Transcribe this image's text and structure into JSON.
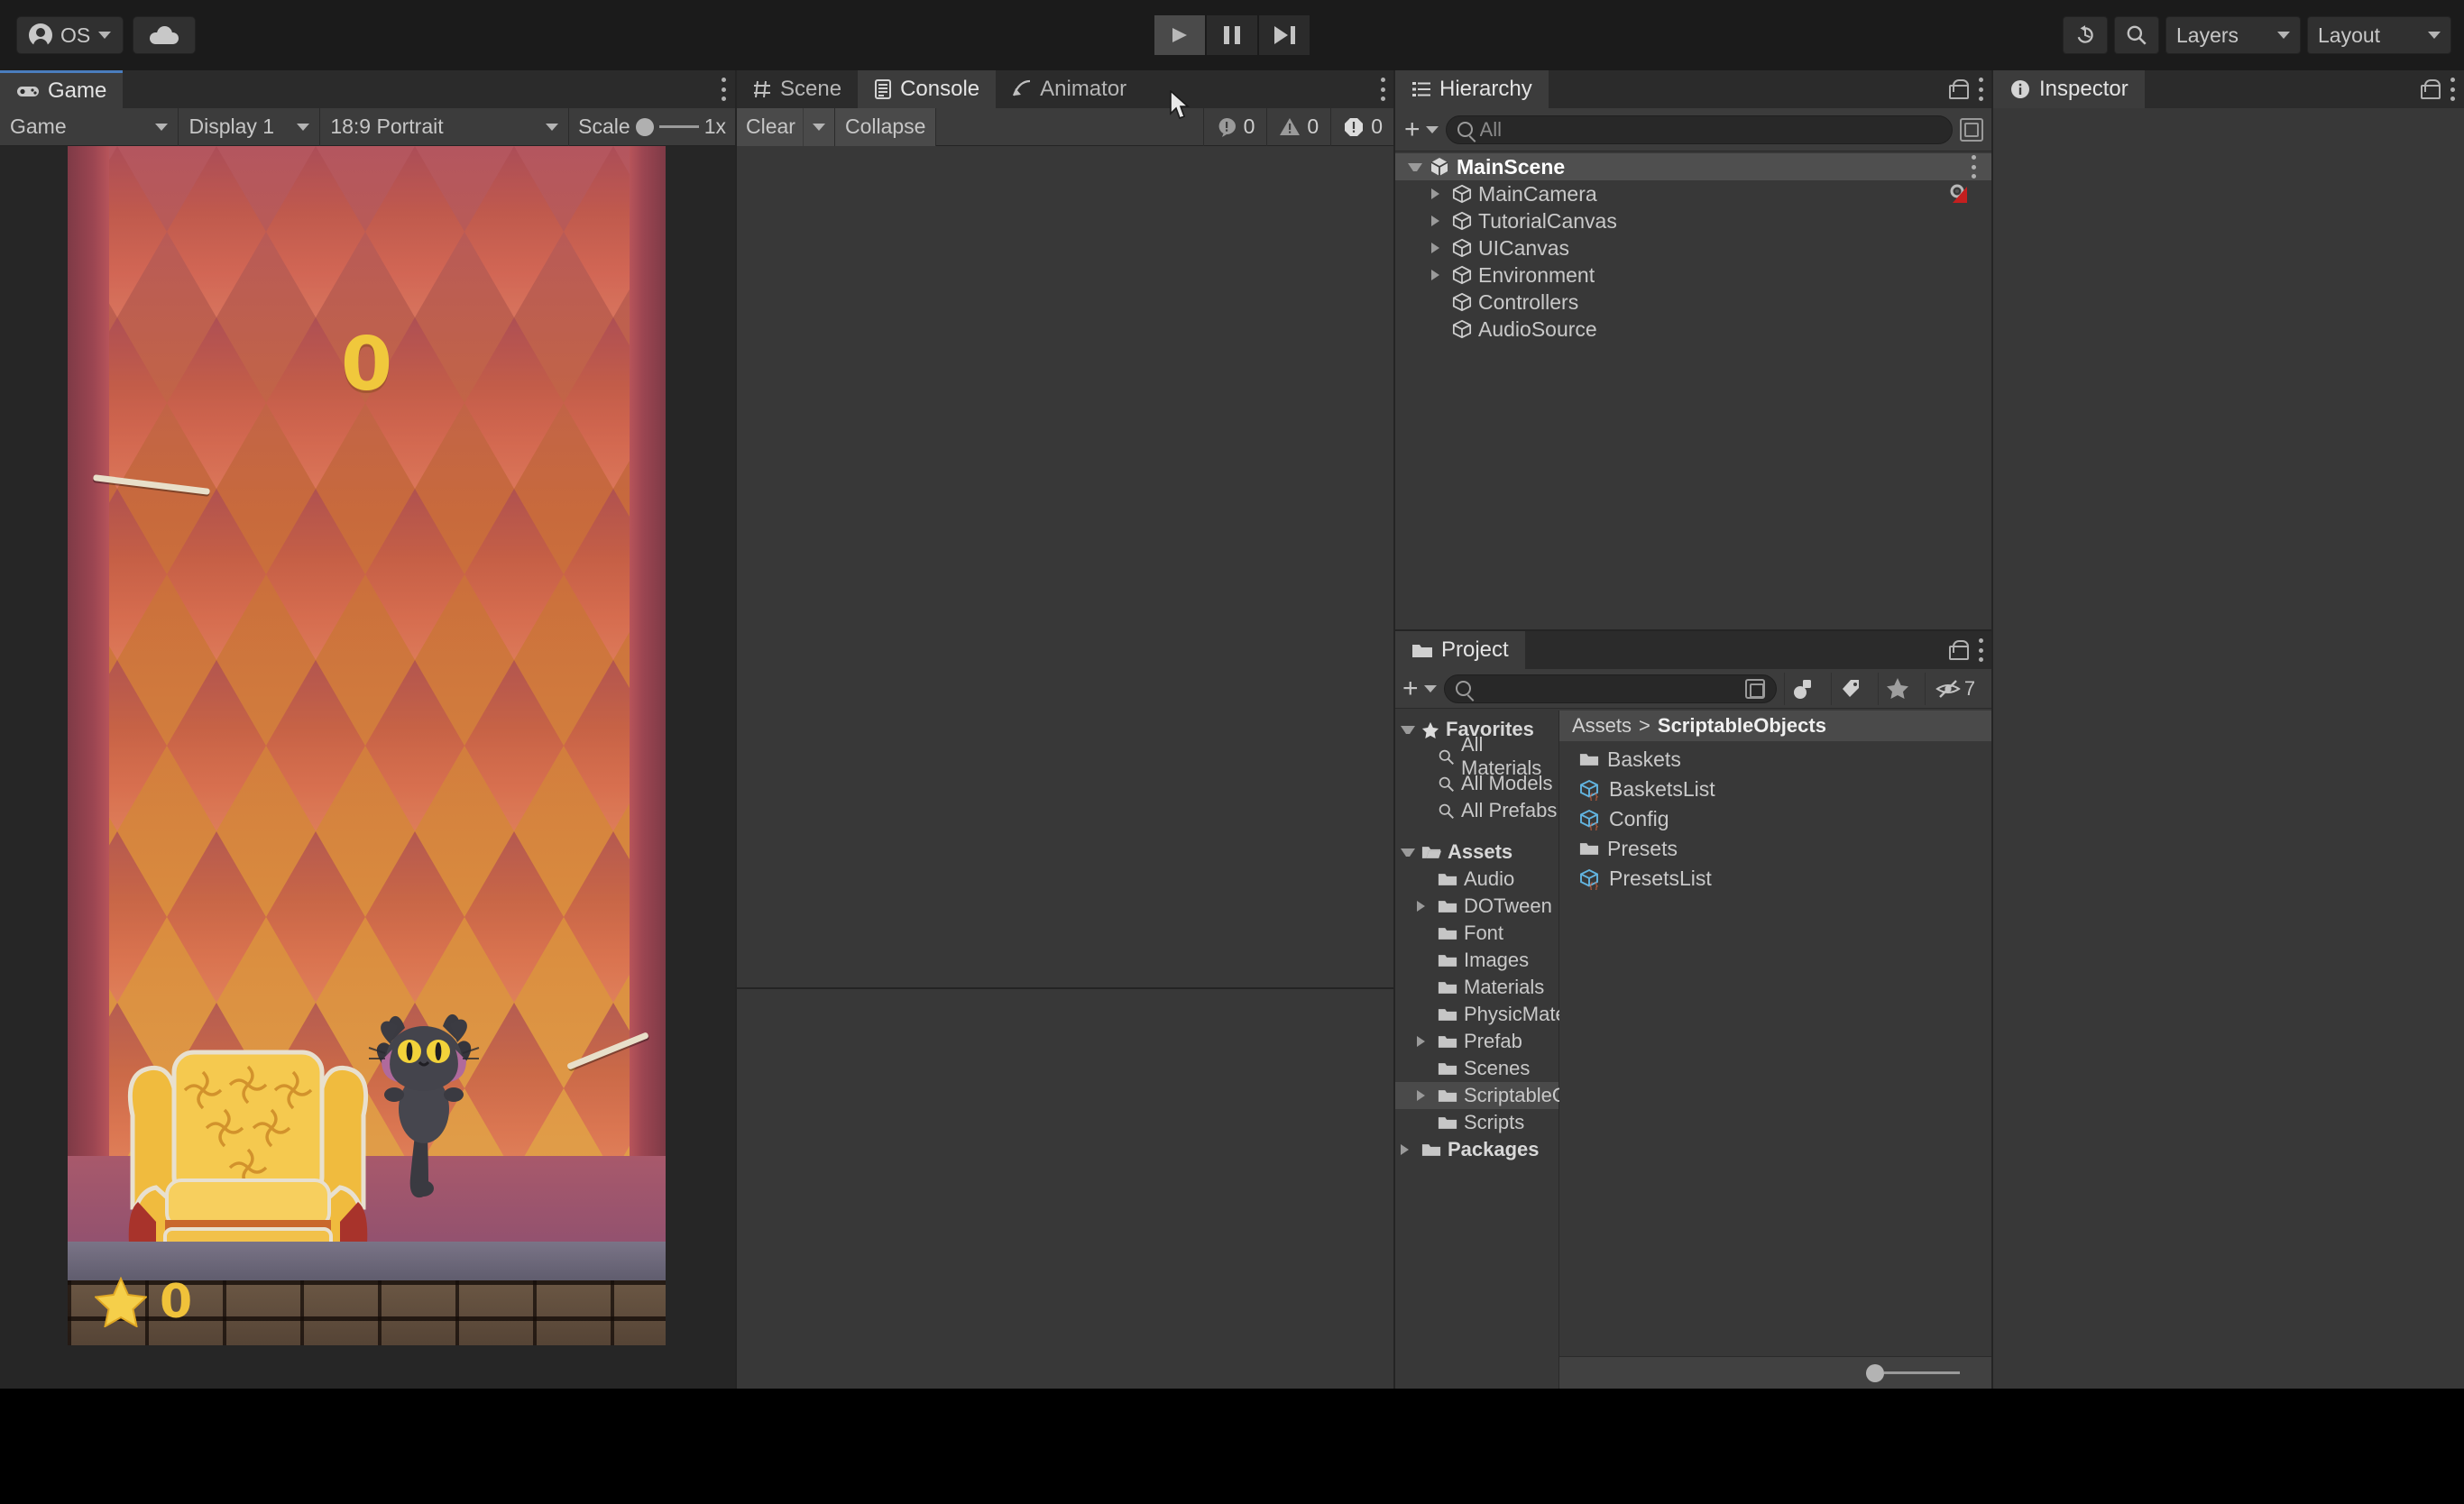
{
  "toolbar": {
    "account_label": "OS",
    "account_icon": "avatar-icon",
    "cloud_icon": "cloud-icon",
    "play_icon": "play-icon",
    "pause_icon": "pause-icon",
    "step_icon": "step-icon",
    "history_icon": "undo-history-icon",
    "search_icon": "search-icon",
    "layers_label": "Layers",
    "layout_label": "Layout"
  },
  "game_panel": {
    "tab_label": "Game",
    "tab_icon": "gamepad-icon",
    "kebab_icon": "kebab-menu-icon",
    "mode_label": "Game",
    "display_label": "Display 1",
    "aspect_label": "18:9 Portrait",
    "scale_label": "Scale",
    "scale_value": "1x",
    "game": {
      "center_score": "0",
      "hud_star_icon": "star-icon",
      "hud_score": "0"
    }
  },
  "console_panel": {
    "tabs": [
      {
        "label": "Scene",
        "icon": "grid-icon",
        "active": false
      },
      {
        "label": "Console",
        "icon": "console-icon",
        "active": true
      },
      {
        "label": "Animator",
        "icon": "animator-icon",
        "active": false
      }
    ],
    "kebab_icon": "kebab-menu-icon",
    "clear_label": "Clear",
    "clear_dropdown_icon": "chevron-down-icon",
    "collapse_label": "Collapse",
    "counters": [
      {
        "name": "log-count",
        "icon": "log-icon",
        "value": "0"
      },
      {
        "name": "warning-count",
        "icon": "warning-icon",
        "value": "0"
      },
      {
        "name": "error-count",
        "icon": "error-icon",
        "value": "0"
      }
    ],
    "messages": []
  },
  "hierarchy_panel": {
    "tab_label": "Hierarchy",
    "tab_icon": "hierarchy-icon",
    "lock_icon": "lock-icon",
    "kebab_icon": "kebab-menu-icon",
    "add_icon": "plus-icon",
    "add_dropdown_icon": "chevron-down-icon",
    "search_placeholder": "All",
    "search_value": "",
    "search_icon": "search-icon",
    "popout_icon": "popout-icon",
    "items": [
      {
        "label": "MainScene",
        "icon": "scene-icon",
        "depth": 0,
        "arrow": "open",
        "selected": true,
        "badge": "",
        "kebab": true
      },
      {
        "label": "MainCamera",
        "icon": "cube-icon",
        "depth": 1,
        "arrow": "closed",
        "selected": false,
        "badge": "prefab-modified-icon",
        "kebab": false
      },
      {
        "label": "TutorialCanvas",
        "icon": "cube-icon",
        "depth": 1,
        "arrow": "closed",
        "selected": false,
        "badge": "",
        "kebab": false
      },
      {
        "label": "UICanvas",
        "icon": "cube-icon",
        "depth": 1,
        "arrow": "closed",
        "selected": false,
        "badge": "",
        "kebab": false
      },
      {
        "label": "Environment",
        "icon": "cube-icon",
        "depth": 1,
        "arrow": "closed",
        "selected": false,
        "badge": "",
        "kebab": false
      },
      {
        "label": "Controllers",
        "icon": "cube-icon",
        "depth": 1,
        "arrow": "none",
        "selected": false,
        "badge": "",
        "kebab": false
      },
      {
        "label": "AudioSource",
        "icon": "cube-icon",
        "depth": 1,
        "arrow": "none",
        "selected": false,
        "badge": "",
        "kebab": false
      }
    ]
  },
  "project_panel": {
    "tab_label": "Project",
    "tab_icon": "folder-icon",
    "lock_icon": "lock-icon",
    "kebab_icon": "kebab-menu-icon",
    "add_icon": "plus-icon",
    "add_dropdown_icon": "chevron-down-icon",
    "search_value": "",
    "search_placeholder": "",
    "search_icon": "search-icon",
    "popout_icon": "popout-icon",
    "filter_icons": [
      "asset-type-filter-icon",
      "label-filter-icon",
      "favorite-filter-icon"
    ],
    "hidden_packages_icon": "eye-off-icon",
    "hidden_packages_count": "7",
    "tree": [
      {
        "label": "Favorites",
        "icon": "star-icon",
        "depth": 0,
        "arrow": "open",
        "bold": true,
        "selected": false
      },
      {
        "label": "All Materials",
        "icon": "search-icon",
        "depth": 1,
        "arrow": "none",
        "bold": false,
        "selected": false
      },
      {
        "label": "All Models",
        "icon": "search-icon",
        "depth": 1,
        "arrow": "none",
        "bold": false,
        "selected": false
      },
      {
        "label": "All Prefabs",
        "icon": "search-icon",
        "depth": 1,
        "arrow": "none",
        "bold": false,
        "selected": false
      },
      {
        "label": "",
        "icon": "spacer",
        "depth": 0,
        "arrow": "none",
        "bold": false,
        "selected": false
      },
      {
        "label": "Assets",
        "icon": "folder-open-icon",
        "depth": 0,
        "arrow": "open",
        "bold": true,
        "selected": false
      },
      {
        "label": "Audio",
        "icon": "folder-icon",
        "depth": 1,
        "arrow": "none",
        "bold": false,
        "selected": false
      },
      {
        "label": "DOTween",
        "icon": "folder-icon",
        "depth": 1,
        "arrow": "closed",
        "bold": false,
        "selected": false
      },
      {
        "label": "Font",
        "icon": "folder-icon",
        "depth": 1,
        "arrow": "none",
        "bold": false,
        "selected": false
      },
      {
        "label": "Images",
        "icon": "folder-icon",
        "depth": 1,
        "arrow": "none",
        "bold": false,
        "selected": false
      },
      {
        "label": "Materials",
        "icon": "folder-icon",
        "depth": 1,
        "arrow": "none",
        "bold": false,
        "selected": false
      },
      {
        "label": "PhysicMaterials",
        "icon": "folder-icon",
        "depth": 1,
        "arrow": "none",
        "bold": false,
        "selected": false
      },
      {
        "label": "Prefab",
        "icon": "folder-icon",
        "depth": 1,
        "arrow": "closed",
        "bold": false,
        "selected": false
      },
      {
        "label": "Scenes",
        "icon": "folder-icon",
        "depth": 1,
        "arrow": "none",
        "bold": false,
        "selected": false
      },
      {
        "label": "ScriptableObjects",
        "icon": "folder-icon",
        "depth": 1,
        "arrow": "closed",
        "bold": false,
        "selected": true
      },
      {
        "label": "Scripts",
        "icon": "folder-icon",
        "depth": 1,
        "arrow": "none",
        "bold": false,
        "selected": false
      },
      {
        "label": "Packages",
        "icon": "folder-icon",
        "depth": 0,
        "arrow": "closed",
        "bold": true,
        "selected": false
      }
    ],
    "breadcrumb": {
      "root": "Assets",
      "separator": ">",
      "current": "ScriptableObjects"
    },
    "contents": [
      {
        "label": "Baskets",
        "icon": "folder-icon"
      },
      {
        "label": "BasketsList",
        "icon": "scriptable-object-icon"
      },
      {
        "label": "Config",
        "icon": "scriptable-object-icon"
      },
      {
        "label": "Presets",
        "icon": "folder-icon"
      },
      {
        "label": "PresetsList",
        "icon": "scriptable-object-icon"
      }
    ]
  },
  "inspector_panel": {
    "tab_label": "Inspector",
    "tab_icon": "info-icon",
    "lock_icon": "lock-icon",
    "kebab_icon": "kebab-menu-icon",
    "content": ""
  },
  "colors": {
    "window_bg": "#383838",
    "toolbar_bg": "#1b1b1b",
    "tabbar_bg": "#2b2b2b",
    "tab_active_bg": "#3c3c3c",
    "accent_blue": "#4a7dbd",
    "selection": "#4a4a4a",
    "text": "#c4c4c4",
    "game_score_yellow": "#f0c83c"
  }
}
